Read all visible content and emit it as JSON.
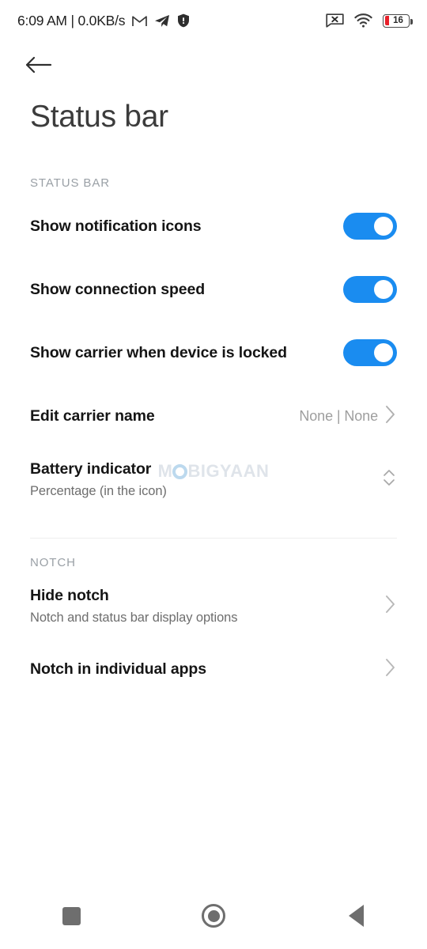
{
  "status_bar": {
    "clock": "6:09 AM | 0.0KB/s",
    "left_icons": [
      "gmail-icon",
      "telegram-icon",
      "shield-icon"
    ],
    "right_icons": [
      "sms-blocked-icon",
      "wifi-icon",
      "battery-icon"
    ],
    "battery_level": "16",
    "battery_color": "#e8202a"
  },
  "header": {
    "back_icon": "back-arrow-icon",
    "title": "Status bar"
  },
  "sections": [
    {
      "label": "STATUS BAR",
      "rows": [
        {
          "title": "Show notification icons",
          "sub": "",
          "control": "toggle",
          "toggle_on": true
        },
        {
          "title": "Show connection speed",
          "sub": "",
          "control": "toggle",
          "toggle_on": true
        },
        {
          "title": "Show carrier when device is locked",
          "sub": "",
          "control": "toggle",
          "toggle_on": true
        },
        {
          "title": "Edit carrier name",
          "sub": "",
          "control": "chevron",
          "value": "None | None"
        },
        {
          "title": "Battery indicator",
          "sub": "Percentage (in the icon)",
          "control": "stepper",
          "value": ""
        }
      ]
    },
    {
      "label": "NOTCH",
      "rows": [
        {
          "title": "Hide notch",
          "sub": "Notch and status bar display options",
          "control": "chevron",
          "value": ""
        },
        {
          "title": "Notch in individual apps",
          "sub": "",
          "control": "chevron",
          "value": ""
        }
      ]
    }
  ],
  "watermark": {
    "before": "M",
    "after": "BIGYAAN"
  },
  "nav_bar": {
    "recents_label": "recents-button",
    "home_label": "home-button",
    "back_label": "back-button"
  },
  "colors": {
    "accent": "#1a8cf0",
    "title": "#151515",
    "subtitle": "#6e6e6e",
    "section": "#9aa0a6"
  }
}
